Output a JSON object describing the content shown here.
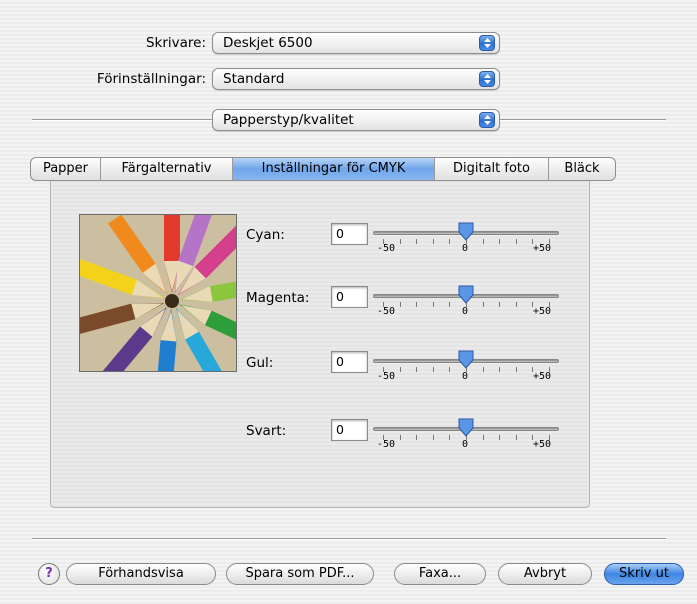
{
  "printer": {
    "label": "Skrivare:",
    "value": "Deskjet 6500"
  },
  "presets": {
    "label": "Förinställningar:",
    "value": "Standard"
  },
  "pane_menu": {
    "value": "Papperstyp/kvalitet"
  },
  "tabs": [
    {
      "label": "Papper",
      "active": false
    },
    {
      "label": "Färgalternativ",
      "active": false
    },
    {
      "label": "Inställningar för CMYK",
      "active": true
    },
    {
      "label": "Digitalt foto",
      "active": false
    },
    {
      "label": "Bläck",
      "active": false
    }
  ],
  "image": {
    "description": "colored-pencils-photo"
  },
  "sliders": [
    {
      "label": "Cyan:",
      "value": "0",
      "min": "-50",
      "mid": "0",
      "max": "+50"
    },
    {
      "label": "Magenta:",
      "value": "0",
      "min": "-50",
      "mid": "0",
      "max": "+50"
    },
    {
      "label": "Gul:",
      "value": "0",
      "min": "-50",
      "mid": "0",
      "max": "+50"
    },
    {
      "label": "Svart:",
      "value": "0",
      "min": "-50",
      "mid": "0",
      "max": "+50"
    }
  ],
  "buttons": {
    "help": "?",
    "preview": "Förhandsvisa",
    "save_pdf": "Spara som PDF...",
    "fax": "Faxa...",
    "cancel": "Avbryt",
    "print": "Skriv ut"
  },
  "colors": {
    "accent": "#3e86e3",
    "help_icon": "#7b2fb5"
  }
}
